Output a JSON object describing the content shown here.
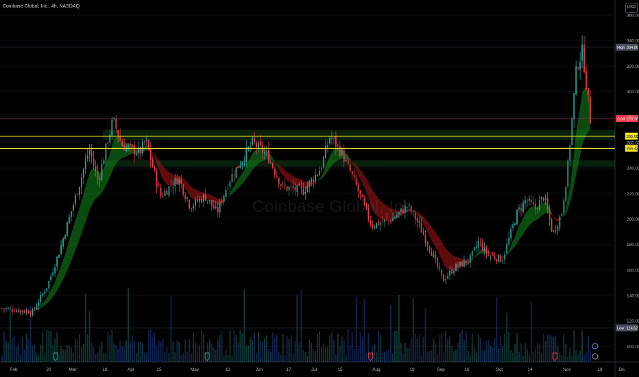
{
  "header": {
    "title": "Coinbase Global, Inc., 4h, NASDAQ",
    "currency": "USD",
    "watermark": "Coinbase Global, Inc."
  },
  "chart_data": {
    "type": "candlestick",
    "ylim": [
      90,
      360
    ],
    "y_ticks": [
      100,
      120,
      140,
      160,
      180,
      200,
      220,
      240,
      260,
      280,
      300,
      320,
      340,
      360
    ],
    "x_ticks": [
      "Feb",
      "20",
      "Mar",
      "18",
      "Apr",
      "15",
      "May",
      "13",
      "Jun",
      "17",
      "Jul",
      "15",
      "Aug",
      "19",
      "Sep",
      "16",
      "Oct",
      "14",
      "Nov",
      "18",
      "De"
    ],
    "price_path": [
      {
        "t": 0.0,
        "price": 130
      },
      {
        "t": 5.5,
        "price": 127
      },
      {
        "t": 8.0,
        "price": 148
      },
      {
        "t": 10.0,
        "price": 175
      },
      {
        "t": 13.5,
        "price": 230
      },
      {
        "t": 15.0,
        "price": 255
      },
      {
        "t": 16.5,
        "price": 230
      },
      {
        "t": 19.0,
        "price": 278
      },
      {
        "t": 20.5,
        "price": 258
      },
      {
        "t": 23.5,
        "price": 252
      },
      {
        "t": 24.5,
        "price": 262
      },
      {
        "t": 27.0,
        "price": 218
      },
      {
        "t": 30.0,
        "price": 232
      },
      {
        "t": 32.0,
        "price": 210
      },
      {
        "t": 34.5,
        "price": 218
      },
      {
        "t": 36.5,
        "price": 205
      },
      {
        "t": 38.5,
        "price": 230
      },
      {
        "t": 42.5,
        "price": 260
      },
      {
        "t": 45.0,
        "price": 250
      },
      {
        "t": 47.5,
        "price": 225
      },
      {
        "t": 51.0,
        "price": 222
      },
      {
        "t": 54.0,
        "price": 240
      },
      {
        "t": 55.5,
        "price": 265
      },
      {
        "t": 57.5,
        "price": 252
      },
      {
        "t": 60.0,
        "price": 225
      },
      {
        "t": 62.5,
        "price": 195
      },
      {
        "t": 66.0,
        "price": 200
      },
      {
        "t": 68.5,
        "price": 210
      },
      {
        "t": 70.0,
        "price": 200
      },
      {
        "t": 72.5,
        "price": 175
      },
      {
        "t": 74.5,
        "price": 152
      },
      {
        "t": 76.5,
        "price": 162
      },
      {
        "t": 79.0,
        "price": 168
      },
      {
        "t": 80.5,
        "price": 182
      },
      {
        "t": 82.0,
        "price": 172
      },
      {
        "t": 84.5,
        "price": 168
      },
      {
        "t": 87.0,
        "price": 205
      },
      {
        "t": 88.5,
        "price": 215
      },
      {
        "t": 90.0,
        "price": 208
      },
      {
        "t": 91.5,
        "price": 218
      },
      {
        "t": 93.0,
        "price": 188
      },
      {
        "t": 94.5,
        "price": 205
      },
      {
        "t": 95.5,
        "price": 240
      },
      {
        "t": 97.0,
        "price": 320
      },
      {
        "t": 98.0,
        "price": 332
      },
      {
        "t": 99.3,
        "price": 278
      }
    ],
    "price_lines": [
      {
        "label": "High",
        "value": 334.86,
        "value_text": "334.86",
        "color": "#4a5060"
      },
      {
        "label": "COIN",
        "value": 278.76,
        "value_text": "278.76",
        "color": "#f23645"
      },
      {
        "label": "",
        "value": 265.0,
        "value_text": "265.00",
        "color": "#f5e32b"
      },
      {
        "label": "",
        "value": 255.42,
        "value_text": "255.42",
        "color": "#f5e32b"
      },
      {
        "label": "Low",
        "value": 114.52,
        "value_text": "114.52",
        "color": "#4a5060"
      }
    ],
    "zones": [
      {
        "low": 262,
        "high": 270,
        "color": "rgba(32,120,44,0.28)"
      },
      {
        "low": 241,
        "high": 246,
        "color": "rgba(32,120,44,0.28)"
      }
    ],
    "event_markers": [
      {
        "t": 9.0,
        "color": "#26a69a"
      },
      {
        "t": 34.5,
        "color": "#26a69a"
      },
      {
        "t": 62.0,
        "color": "#f23645"
      },
      {
        "t": 93.0,
        "color": "#f23645"
      }
    ],
    "bull_color": "#26a69a",
    "bear_color": "#f23645",
    "bull_fill": "rgba(20,140,30,0.55)",
    "bear_fill": "rgba(160,20,20,0.6)",
    "grid": true
  }
}
